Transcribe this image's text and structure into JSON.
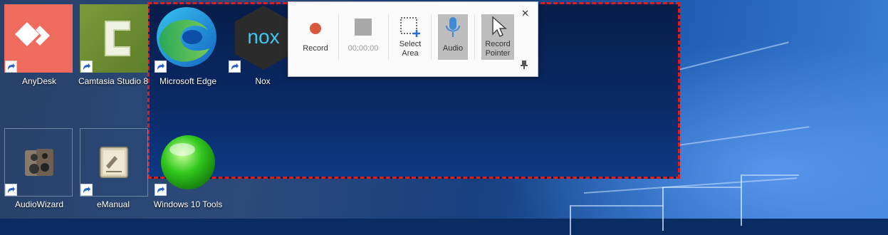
{
  "desktop_icons": [
    {
      "label": "AnyDesk",
      "icon": "anydesk-icon"
    },
    {
      "label": "Camtasia Studio 8",
      "icon": "camtasia-icon"
    },
    {
      "label": "Microsoft Edge",
      "icon": "edge-icon"
    },
    {
      "label": "Nox",
      "icon": "nox-icon"
    },
    {
      "label": "AudioWizard",
      "icon": "audiowizard-icon"
    },
    {
      "label": "eManual",
      "icon": "emanual-icon"
    },
    {
      "label": "Windows 10 Tools",
      "icon": "windows-10-tools-icon"
    }
  ],
  "toolbar": {
    "record_label": "Record",
    "timer": "00:00:00",
    "select_area_label": "Select\nArea",
    "audio_label": "Audio",
    "record_pointer_label": "Record\nPointer",
    "close_symbol": "✕",
    "pin_symbol": "⊥"
  },
  "colors": {
    "selection_border": "#e31b1b",
    "record_dot": "#d9573a",
    "audio_mic": "#3e8ad6",
    "anydesk_bg": "#ef6b5e"
  }
}
